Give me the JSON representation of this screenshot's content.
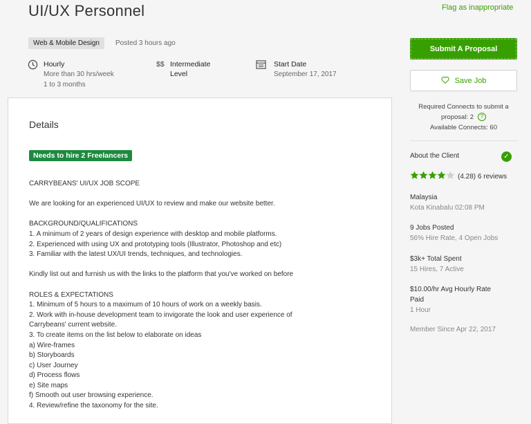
{
  "job": {
    "title": "UI/UX Personnel",
    "flag_label": "Flag as inappropriate",
    "category": "Web & Mobile Design",
    "posted": "Posted 3 hours ago"
  },
  "meta": {
    "type_label": "Hourly",
    "hours": "More than 30 hrs/week",
    "duration": "1 to 3 months",
    "level_icon": "$$",
    "level_line1": "Intermediate",
    "level_line2": "Level",
    "start_label": "Start Date",
    "start_date": "September 17, 2017"
  },
  "details": {
    "heading": "Details",
    "needs_badge": "Needs to hire 2 Freelancers",
    "description": "CARRYBEANS' UI/UX JOB SCOPE\n\nWe are looking for an experienced UI/UX to review and make our website better.\n\nBACKGROUND/QUALIFICATIONS\n1. A minimum of 2 years of design experience with desktop and mobile platforms.\n2. Experienced with using UX and prototyping tools (Illustrator, Photoshop and etc)\n3. Familiar with the latest UX/UI trends, techniques, and technologies.\n\nKindly list out and furnish us with the links to the platform that you've worked on before\n\nROLES & EXPECTATIONS\n1. Minimum of 5 hours to a maximum of 10 hours of work on a weekly basis.\n2. Work with in-house development team to invigorate the look and user experience of\nCarrybeans' current website.\n3. To create items on the list below to elaborate on ideas\na) Wire-frames\nb) Storyboards\nc) User Journey\nd) Process flows\ne) Site maps\nf) Smooth out user browsing experience.\n4. Review/refine the taxonomy for the site."
  },
  "actions": {
    "submit_label": "Submit A Proposal",
    "save_label": "Save Job",
    "connects_line1": "Required Connects to submit a",
    "connects_line2": "proposal: 2",
    "connects_line3": "Available Connects: 60"
  },
  "client": {
    "heading": "About the Client",
    "rating": "(4.28) 6 reviews",
    "rating_value": 4.28,
    "rating_max": 5,
    "country": "Malaysia",
    "local_time": "Kota Kinabalu 02:08 PM",
    "jobs_posted": "9 Jobs Posted",
    "jobs_detail": "56% Hire Rate, 4 Open Jobs",
    "total_spent": "$3k+ Total Spent",
    "hires_detail": "15 Hires, 7 Active",
    "avg_rate_line1": "$10.00/hr Avg Hourly Rate",
    "avg_rate_line2": "Paid",
    "hours_paid": "1 Hour",
    "member_since": "Member Since Apr 22, 2017"
  },
  "colors": {
    "brand_green": "#37a000",
    "badge_green": "#1e8a3f"
  }
}
